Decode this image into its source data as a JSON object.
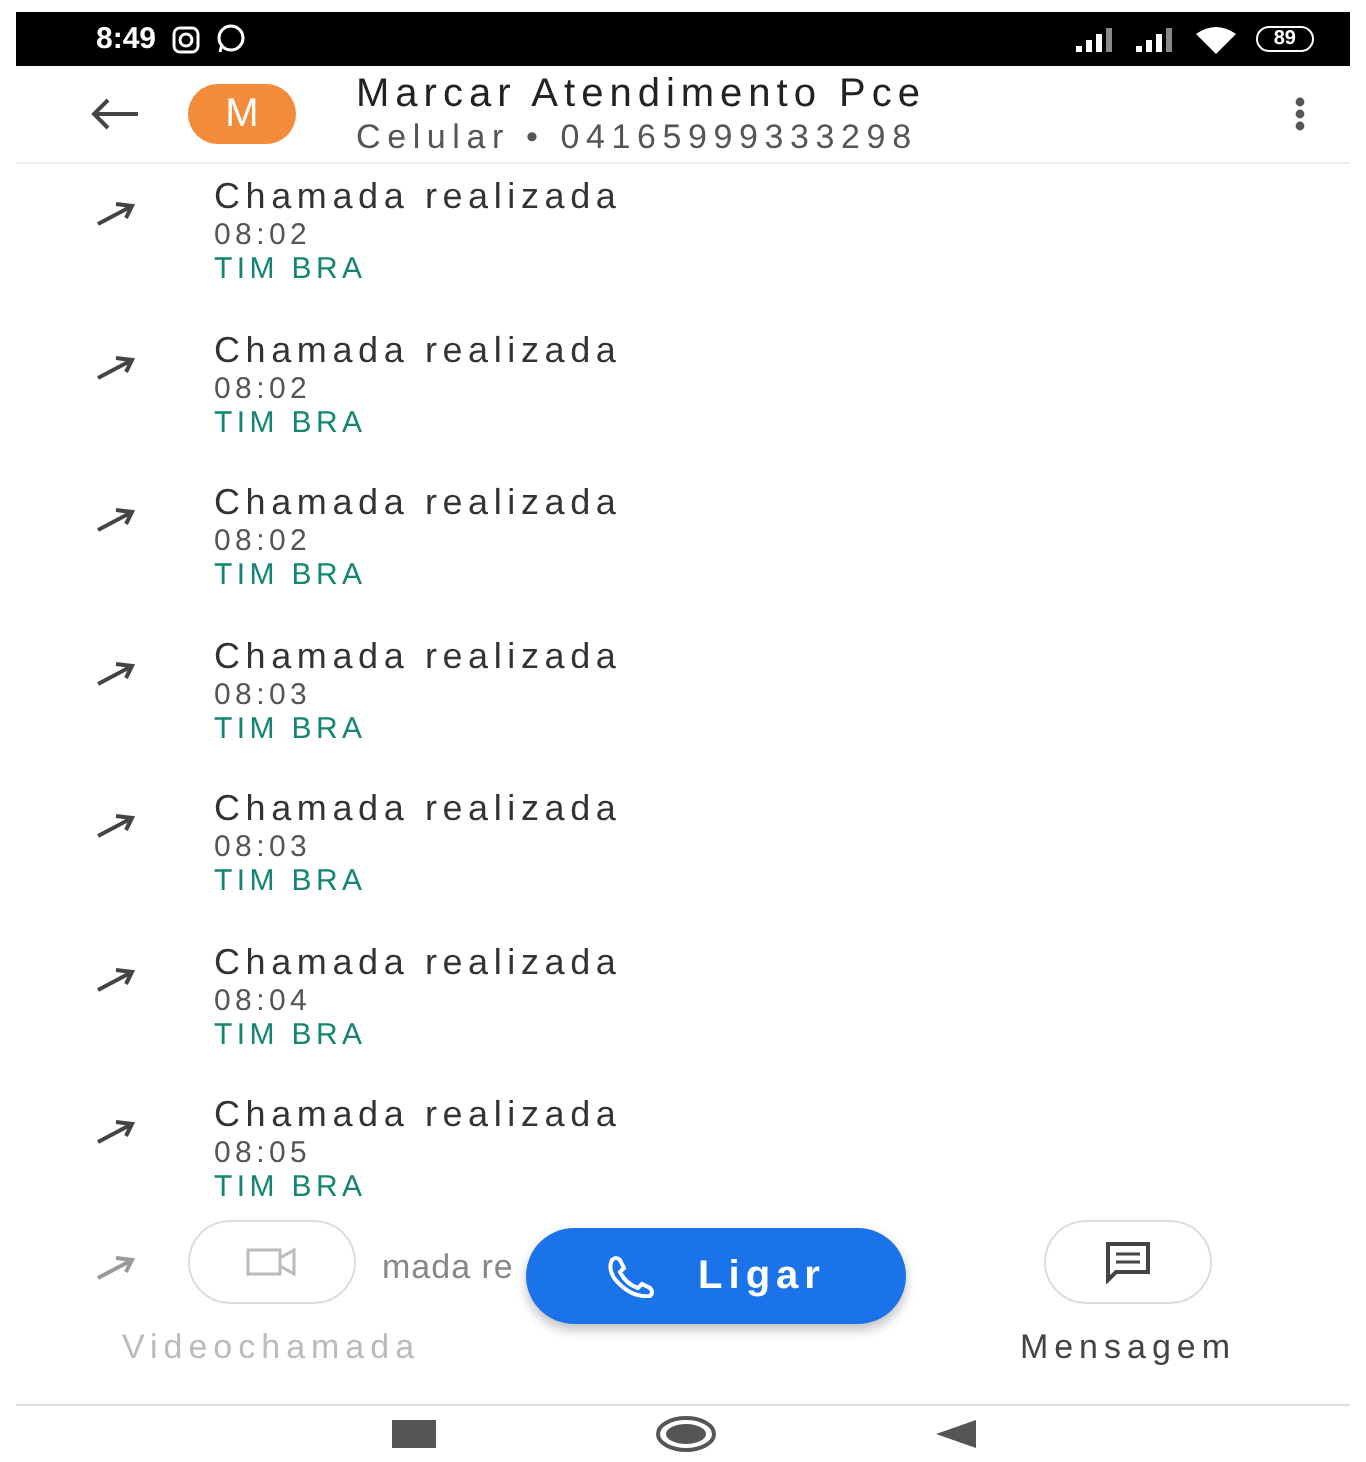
{
  "status_bar": {
    "time": "8:49",
    "battery": "89"
  },
  "header": {
    "avatar_letter": "M",
    "name": "Marcar Atendimento Pce",
    "subtitle": "Celular • 04165999333298"
  },
  "calls": [
    {
      "kind": "outgoing",
      "title": "Chamada realizada",
      "time": "08:02",
      "carrier": "TIM BRA"
    },
    {
      "kind": "outgoing",
      "title": "Chamada realizada",
      "time": "08:02",
      "carrier": "TIM BRA"
    },
    {
      "kind": "outgoing",
      "title": "Chamada realizada",
      "time": "08:02",
      "carrier": "TIM BRA"
    },
    {
      "kind": "outgoing",
      "title": "Chamada realizada",
      "time": "08:03",
      "carrier": "TIM BRA"
    },
    {
      "kind": "outgoing",
      "title": "Chamada realizada",
      "time": "08:03",
      "carrier": "TIM BRA"
    },
    {
      "kind": "outgoing",
      "title": "Chamada realizada",
      "time": "08:04",
      "carrier": "TIM BRA"
    },
    {
      "kind": "outgoing",
      "title": "Chamada realizada",
      "time": "08:05",
      "carrier": "TIM BRA"
    }
  ],
  "partial_row": {
    "kind": "outgoing",
    "text": "mada re"
  },
  "actions": [
    {
      "kind": "video",
      "label": "Videochamada",
      "disabled": true
    },
    {
      "kind": "call",
      "label": "Ligar"
    },
    {
      "kind": "message",
      "label": "Mensagem",
      "disabled": false
    }
  ]
}
